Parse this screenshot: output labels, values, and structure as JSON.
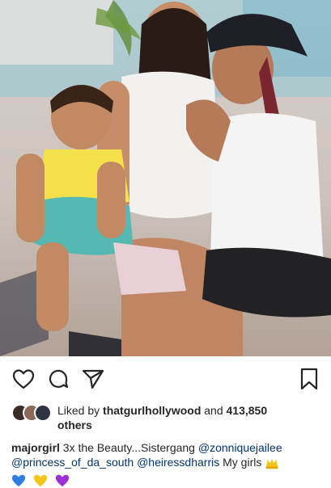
{
  "post": {
    "photo_alt": "",
    "liked_by_prefix": "Liked by",
    "liked_by_user": "thatgurlhollywood",
    "liked_by_mid": "and",
    "liked_by_count": "413,850",
    "liked_by_suffix": "others",
    "caption_user": "majorgirl",
    "caption_text": "3x the Beauty...Sistergang",
    "mentions": [
      "@zonniquejailee",
      "@princess_of_da_south",
      "@heiressdharris"
    ],
    "caption_tail": "My girls",
    "emojis": [
      "crown-emoji",
      "blue-heart-emoji",
      "yellow-heart-emoji",
      "purple-heart-emoji"
    ]
  },
  "actions": {
    "like_icon": "heart-outline-icon",
    "comment_icon": "comment-bubble-icon",
    "share_icon": "paper-plane-icon",
    "save_icon": "bookmark-icon"
  },
  "colors": {
    "text": "#262626",
    "mention": "#003569",
    "blue_heart": "#2f7de1",
    "yellow_heart": "#f5c518",
    "purple_heart": "#9b30d9"
  }
}
